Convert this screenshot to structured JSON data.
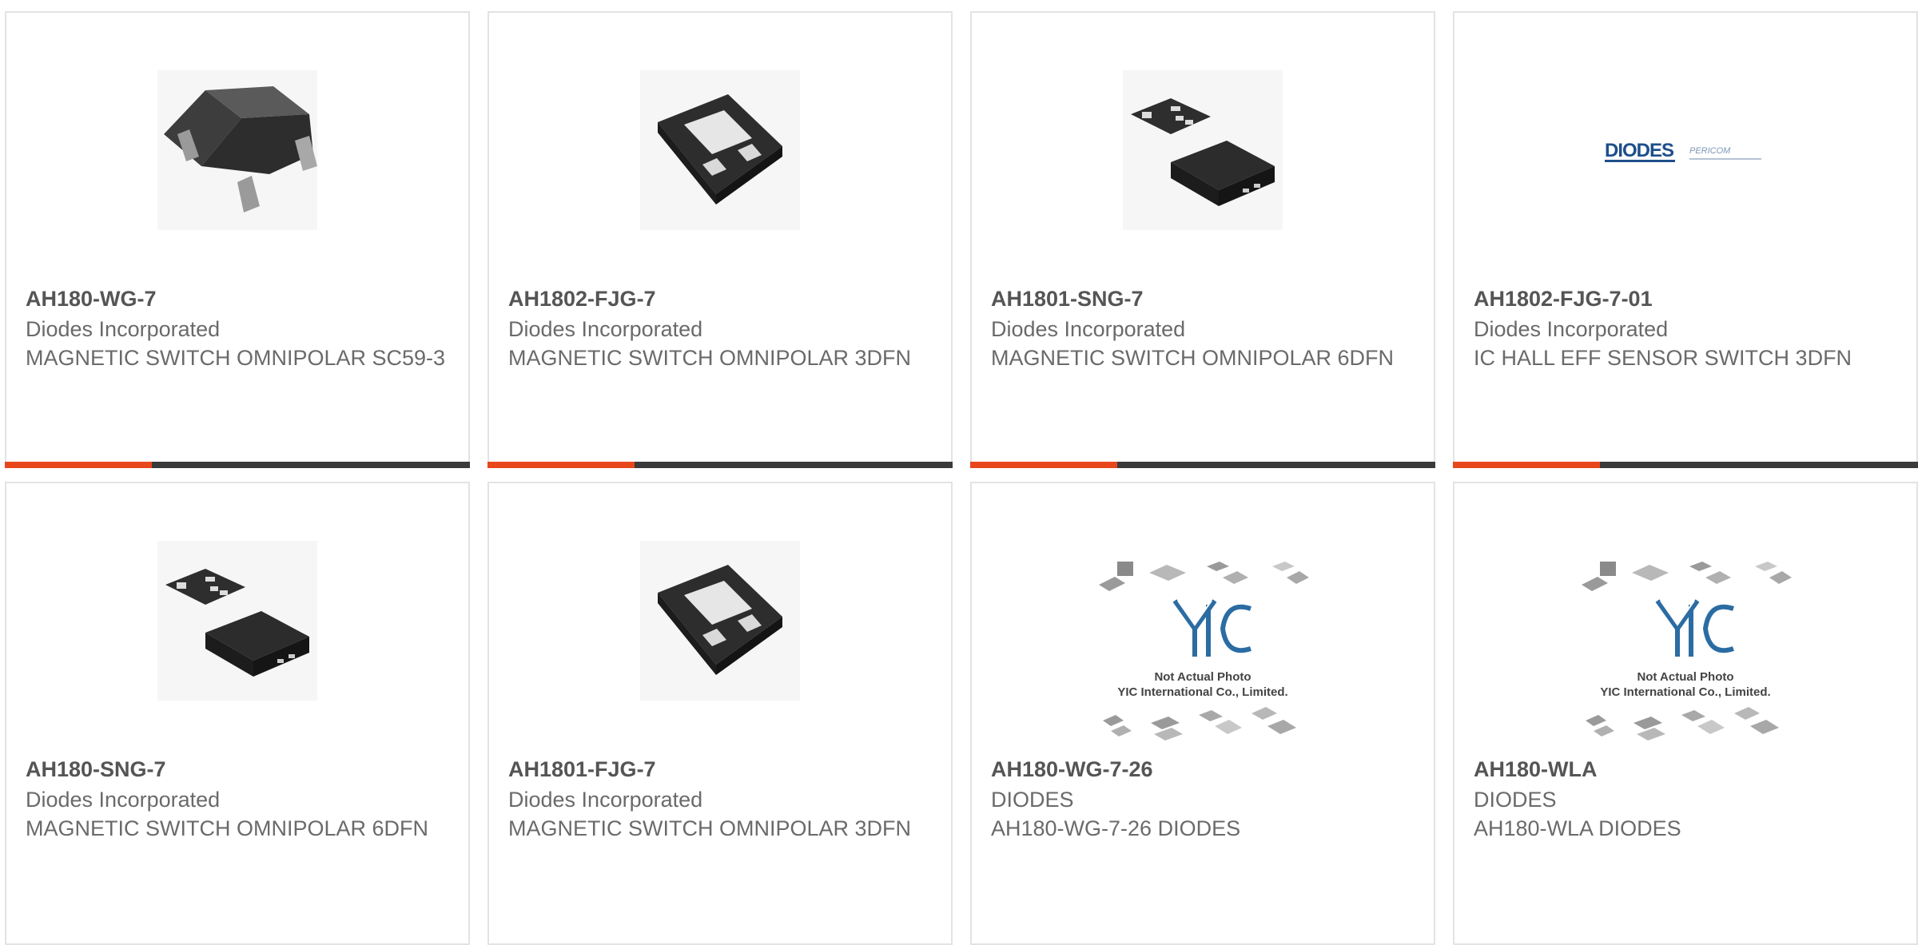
{
  "products": [
    {
      "part": "AH180-WG-7",
      "manufacturer": "Diodes Incorporated",
      "description": "MAGNETIC SWITCH OMNIPOLAR SC59-3",
      "image_icon": "sot23-package-icon"
    },
    {
      "part": "AH1802-FJG-7",
      "manufacturer": "Diodes Incorporated",
      "description": "MAGNETIC SWITCH OMNIPOLAR 3DFN",
      "image_icon": "dfn3-package-icon"
    },
    {
      "part": "AH1801-SNG-7",
      "manufacturer": "Diodes Incorporated",
      "description": "MAGNETIC SWITCH OMNIPOLAR 6DFN",
      "image_icon": "dfn6-package-icon"
    },
    {
      "part": "AH1802-FJG-7-01",
      "manufacturer": "Diodes Incorporated",
      "description": "IC HALL EFF SENSOR SWITCH 3DFN",
      "image_icon": "diodes-logo-icon"
    },
    {
      "part": "AH180-SNG-7",
      "manufacturer": "Diodes Incorporated",
      "description": "MAGNETIC SWITCH OMNIPOLAR 6DFN",
      "image_icon": "dfn6-package-icon"
    },
    {
      "part": "AH1801-FJG-7",
      "manufacturer": "Diodes Incorporated",
      "description": "MAGNETIC SWITCH OMNIPOLAR 3DFN",
      "image_icon": "dfn3-package-icon"
    },
    {
      "part": "AH180-WG-7-26",
      "manufacturer": "DIODES",
      "description": "AH180-WG-7-26 DIODES",
      "image_icon": "not-actual-photo-icon"
    },
    {
      "part": "AH180-WLA",
      "manufacturer": "DIODES",
      "description": "AH180-WLA DIODES",
      "image_icon": "not-actual-photo-icon"
    }
  ],
  "logo_text": {
    "diodes": "DIODES",
    "pericom": "PERICOM",
    "not_actual_line1": "Not Actual Photo",
    "not_actual_line2": "YIC International Co., Limited.",
    "yic": "YIC"
  },
  "colors": {
    "accent": "#e8471c",
    "bar": "#3a3a3a",
    "part_text": "#555555",
    "body_text": "#6a6a6a",
    "border": "#e3e3e3"
  }
}
